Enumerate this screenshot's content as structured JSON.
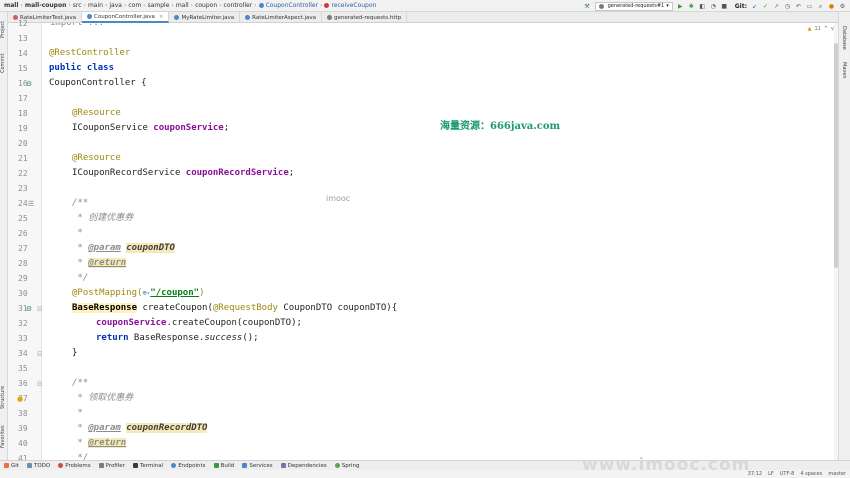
{
  "breadcrumbs": [
    "mall",
    "mall-coupon",
    "src",
    "main",
    "java",
    "com",
    "sample",
    "mall",
    "coupon",
    "controller",
    "CouponController",
    "receiveCoupon"
  ],
  "run_config": "generated-requests#1",
  "git_label": "Git:",
  "tabs": [
    {
      "label": "RateLimiterTest.java",
      "color": "#d65d5d"
    },
    {
      "label": "CouponController.java",
      "color": "#4a88c7",
      "active": true
    },
    {
      "label": "MyRateLimiter.java",
      "color": "#4a88c7"
    },
    {
      "label": "RateLimiterAspect.java",
      "color": "#4a88c7"
    },
    {
      "label": "generated-requests.http",
      "color": "#7a7a7a"
    }
  ],
  "left_tools": [
    "Project",
    "Commit",
    "Structure",
    "Favorites"
  ],
  "right_tools": [
    "Database",
    "Maven"
  ],
  "inspection": {
    "warnings": "11",
    "up": "^",
    "down": "v"
  },
  "code_lines": [
    {
      "n": "12",
      "text": "import ..."
    },
    {
      "n": "13",
      "text": ""
    },
    {
      "n": "14",
      "text": "@RestController"
    },
    {
      "n": "15",
      "text": "public class"
    },
    {
      "n": "16",
      "text": "CouponController {"
    },
    {
      "n": "17",
      "text": ""
    },
    {
      "n": "18",
      "text": "@Resource"
    },
    {
      "n": "19",
      "text": "ICouponService couponService;"
    },
    {
      "n": "20",
      "text": ""
    },
    {
      "n": "21",
      "text": "@Resource"
    },
    {
      "n": "22",
      "text": "ICouponRecordService couponRecordService;"
    },
    {
      "n": "23",
      "text": ""
    },
    {
      "n": "24",
      "text": "/**"
    },
    {
      "n": "25",
      "text": "* 创建优惠券"
    },
    {
      "n": "26",
      "text": "*"
    },
    {
      "n": "27",
      "text": "* @param couponDTO"
    },
    {
      "n": "28",
      "text": "* @return"
    },
    {
      "n": "29",
      "text": "*/"
    },
    {
      "n": "30",
      "text": "@PostMapping(\"/coupon\")"
    },
    {
      "n": "31",
      "text": "BaseResponse createCoupon(@RequestBody CouponDTO couponDTO){"
    },
    {
      "n": "32",
      "text": "couponService.createCoupon(couponDTO);"
    },
    {
      "n": "33",
      "text": "return BaseResponse.success();"
    },
    {
      "n": "34",
      "text": "}"
    },
    {
      "n": "35",
      "text": ""
    },
    {
      "n": "36",
      "text": "/**"
    },
    {
      "n": "37",
      "text": "* 领取优惠券"
    },
    {
      "n": "38",
      "text": "*"
    },
    {
      "n": "39",
      "text": "* @param couponRecordDTO"
    },
    {
      "n": "40",
      "text": "* @return"
    },
    {
      "n": "41",
      "text": "*/"
    }
  ],
  "code_tokens": {
    "rest_controller": "@RestController",
    "public_class": "public class",
    "class_decl": "CouponController {",
    "resource": "@Resource",
    "icoupon_service": "ICouponService ",
    "coupon_service": "couponService",
    "semicolon": ";",
    "icoupon_record_service": "ICouponRecordService ",
    "coupon_record_service": "couponRecordService",
    "doc_open": "/**",
    "doc_create": " * 创建优惠券",
    "doc_star": " *",
    "doc_star_prefix": " * ",
    "param_tag": "@param",
    "param_coupon_dto": "couponDTO",
    "return_tag": "@return",
    "doc_close": " */",
    "post_mapping": "@PostMapping(",
    "mapping_path": "\"/coupon\"",
    "close_paren": ")",
    "base_response": "BaseResponse",
    "create_coupon_sig": " createCoupon(",
    "request_body": "@RequestBody",
    "sig_rest": " CouponDTO couponDTO){",
    "call_rest": ".createCoupon(couponDTO);",
    "return_kw": "return",
    "return_rest": " BaseResponse.",
    "success_call": "success",
    "success_tail": "();",
    "close_brace": "}",
    "doc_receive": " * 领取优惠券",
    "param_coupon_record_dto": "couponRecordDTO"
  },
  "watermarks": {
    "green": "海量资源：666java.com",
    "imooc_small": "imooc",
    "imooc_big": "www.imooc.com"
  },
  "bottom_tools": [
    {
      "label": "Git",
      "icon": "git-icon"
    },
    {
      "label": "TODO",
      "icon": "todo-icon"
    },
    {
      "label": "Problems",
      "icon": "problems-icon"
    },
    {
      "label": "Profiler",
      "icon": "profiler-icon"
    },
    {
      "label": "Terminal",
      "icon": "terminal-icon"
    },
    {
      "label": "Endpoints",
      "icon": "endpoints-icon"
    },
    {
      "label": "Build",
      "icon": "build-icon"
    },
    {
      "label": "Services",
      "icon": "services-icon"
    },
    {
      "label": "Dependencies",
      "icon": "dependencies-icon"
    },
    {
      "label": "Spring",
      "icon": "spring-icon"
    }
  ],
  "status": {
    "position": "37:12",
    "lf": "LF",
    "encoding": "UTF-8",
    "indent": "4 spaces",
    "branch": "master"
  },
  "colors": {
    "accent": "#4a88c7",
    "annotation": "#9e880d",
    "keyword": "#0033b3",
    "field": "#871094",
    "watermark_green": "#1a9b6a"
  }
}
